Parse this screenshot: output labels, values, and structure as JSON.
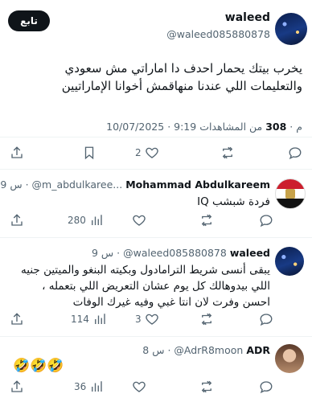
{
  "main_tweet": {
    "follow_label": "تابع",
    "author_name": "waleed",
    "author_handle": "@waleed085880878",
    "text_line1": "يخرب بيتك يحمار احدف دا اماراتي مش سعودي",
    "text_line2": "والتعليمات اللي عندنا منهاقمش أخوانا الإماراتيين",
    "date": "10/07/2025",
    "time": "9:19 م",
    "views_count": "308",
    "views_label": "من المشاهدات",
    "like_count": "2"
  },
  "replies": [
    {
      "name": "Mohammad Abdulkareem",
      "handle": "@m_abdulkaree...",
      "time": "9 س",
      "text_lines": [
        "فردة شبشب IQ"
      ],
      "views": "280"
    },
    {
      "name": "waleed",
      "handle": "@waleed085880878",
      "time": "9 س",
      "text_lines": [
        "يبقى أنسى شريط الترامادول وبكيته البنغو والميتين جنيه",
        "اللي بيدوهالك كل يوم عشان التعريض اللي بتعمله ،",
        "احسن وفرت لان انتا غبي وفيه غيرك الوفات"
      ],
      "likes": "3",
      "views": "114"
    },
    {
      "name": "ADR",
      "handle": "@AdrR8moon",
      "time": "8 س",
      "text_lines": [
        "🤣🤣🤣"
      ],
      "views": "36"
    }
  ],
  "icons": {
    "reply": "reply-icon",
    "retweet": "retweet-icon",
    "like": "heart-icon",
    "bookmark": "bookmark-icon",
    "share": "share-icon",
    "views": "views-icon"
  }
}
